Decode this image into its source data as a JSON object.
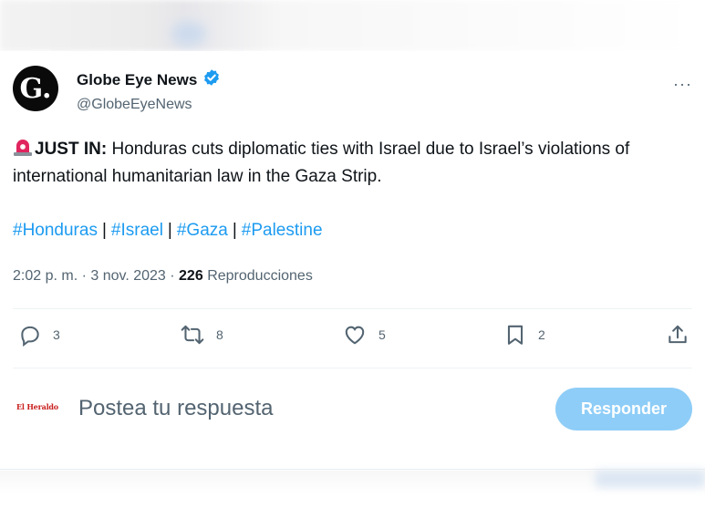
{
  "tweet": {
    "author": {
      "display_name": "Globe Eye News",
      "handle": "@GlobeEyeNews",
      "avatar_letter": "G.",
      "verified": true
    },
    "more_label": "···",
    "text": {
      "prefix_emoji": "siren",
      "lead": "JUST IN:",
      "body": " Honduras cuts diplomatic ties with Israel due to Israel’s violations of international humanitarian law in the Gaza Strip."
    },
    "hashtags": [
      "#Honduras",
      "#Israel",
      "#Gaza",
      "#Palestine"
    ],
    "hashtag_separator": "|",
    "meta": {
      "time": "2:02 p. m.",
      "sep": " · ",
      "date": "3 nov. 2023",
      "views_count": "226",
      "views_label": "Reproducciones"
    },
    "actions": {
      "replies": "3",
      "reposts": "8",
      "likes": "5",
      "bookmarks": "2"
    }
  },
  "reply_box": {
    "watermark": "El Heraldo",
    "placeholder": "Postea tu respuesta",
    "button_label": "Responder"
  },
  "colors": {
    "accent": "#1d9bf0",
    "button_disabled": "#8ecdf7",
    "secondary_text": "#536471",
    "siren_red": "#e0245e"
  }
}
